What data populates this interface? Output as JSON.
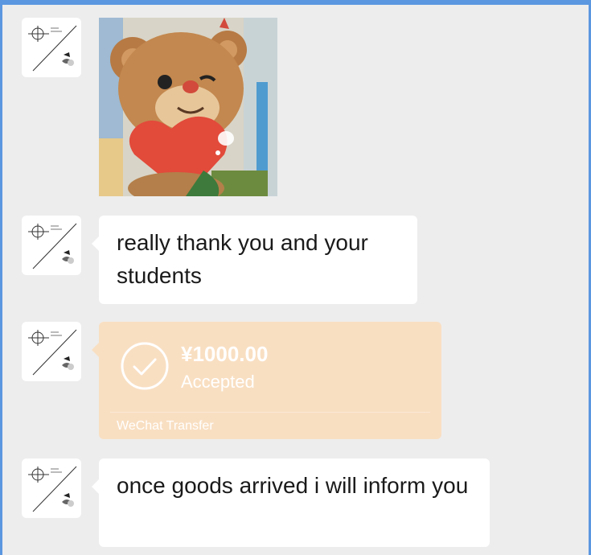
{
  "theme": {
    "chat_background": "#ededed",
    "screenshot_border": "#5b97e0",
    "bubble_color": "#ffffff",
    "transfer_bubble_color": "#f9dfc2",
    "transfer_text_color": "#ffffff"
  },
  "chat": {
    "sender_avatar_icon": "sketch-logo-avatar",
    "messages": [
      {
        "type": "image",
        "description_icon": "teddy-bear-heart-photo"
      },
      {
        "type": "text",
        "text": "really thank you and your students"
      },
      {
        "type": "transfer",
        "amount": "¥1000.00",
        "status": "Accepted",
        "label": "WeChat Transfer",
        "icon": "check-circle-icon"
      },
      {
        "type": "text",
        "text": "once goods arrived i will inform you"
      }
    ]
  }
}
